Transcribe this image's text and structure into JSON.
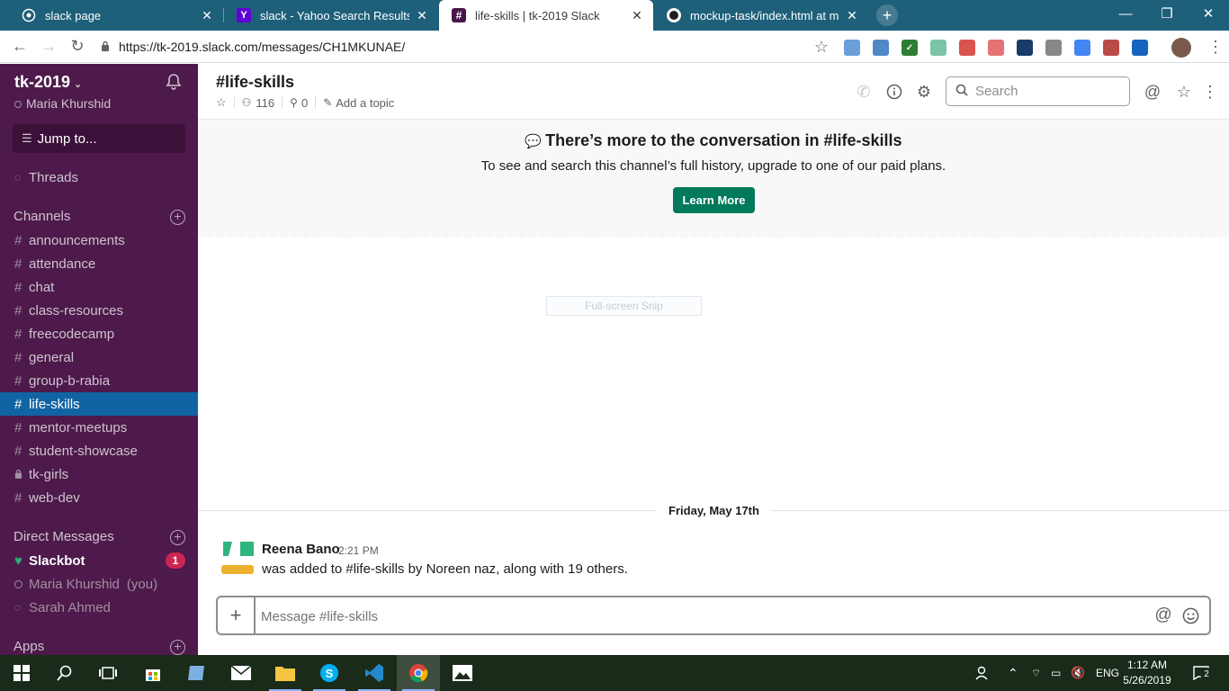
{
  "browser": {
    "tabs": [
      {
        "title": "slack page",
        "icon": "chrome-globe-icon"
      },
      {
        "title": "slack - Yahoo Search Results",
        "icon": "yahoo-icon"
      },
      {
        "title": "life-skills | tk-2019 Slack",
        "icon": "slack-icon"
      },
      {
        "title": "mockup-task/index.html at maste",
        "icon": "github-icon"
      }
    ],
    "url": "https://tk-2019.slack.com/messages/CH1MKUNAE/"
  },
  "sidebar": {
    "workspace": "tk-2019",
    "user": "Maria Khurshid",
    "jump_to": "Jump to...",
    "threads": "Threads",
    "channels_heading": "Channels",
    "channels": [
      {
        "name": "announcements"
      },
      {
        "name": "attendance"
      },
      {
        "name": "chat"
      },
      {
        "name": "class-resources"
      },
      {
        "name": "freecodecamp"
      },
      {
        "name": "general"
      },
      {
        "name": "group-b-rabia"
      },
      {
        "name": "life-skills",
        "active": true
      },
      {
        "name": "mentor-meetups"
      },
      {
        "name": "student-showcase"
      },
      {
        "name": "tk-girls",
        "private": true
      },
      {
        "name": "web-dev"
      }
    ],
    "dm_heading": "Direct Messages",
    "dms": [
      {
        "name": "Slackbot",
        "badge": "1"
      },
      {
        "name": "Maria Khurshid",
        "suffix": "(you)"
      },
      {
        "name": "Sarah Ahmed"
      }
    ],
    "apps_heading": "Apps"
  },
  "channel": {
    "title": "#life-skills",
    "members": "116",
    "pins": "0",
    "topic_link": "Add a topic",
    "search_placeholder": "Search"
  },
  "banner": {
    "title": "There’s more to the conversation in #life-skills",
    "subtitle": "To see and search this channel’s full history, upgrade to one of our paid plans.",
    "button": "Learn More"
  },
  "snip_label": "Full-screen Snip",
  "messages": {
    "date_divider": "Friday, May 17th",
    "items": [
      {
        "author": "Reena Bano",
        "time": "2:21 PM",
        "text": "was added to #life-skills by Noreen naz, along with 19 others."
      }
    ]
  },
  "composer": {
    "placeholder": "Message #life-skills"
  },
  "taskbar": {
    "language": "ENG",
    "time": "1:12 AM",
    "date": "5/26/2019",
    "notifications": "2"
  },
  "colors": {
    "sidebar_bg": "#4d1a4b",
    "active_channel": "#1164a3",
    "learn_more_button": "#007a5a",
    "badge": "#cd2553",
    "tab_strip": "#1e5f7a"
  }
}
